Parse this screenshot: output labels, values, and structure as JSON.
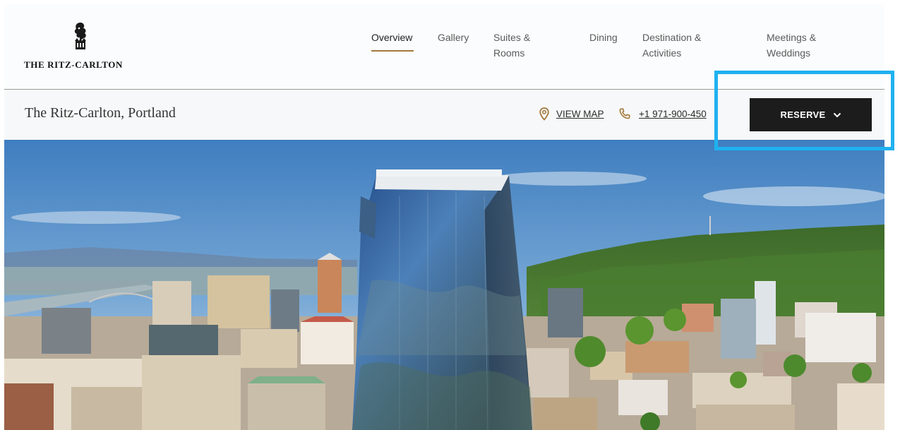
{
  "brand": {
    "logo_text": "THE RITZ-CARLTON",
    "logo_icon": "lion-crown-icon"
  },
  "nav": {
    "items": [
      {
        "label_lines": [
          "Overview"
        ],
        "active": true
      },
      {
        "label_lines": [
          "Gallery"
        ]
      },
      {
        "label_lines": [
          "Suites &",
          "Rooms"
        ]
      },
      {
        "label_lines": [
          "Dining"
        ]
      },
      {
        "label_lines": [
          "Destination &",
          "Activities"
        ]
      },
      {
        "label_lines": [
          "Meetings &",
          "Weddings"
        ]
      }
    ]
  },
  "property": {
    "name": "The Ritz-Carlton, Portland",
    "map_link": "VIEW MAP",
    "map_icon": "map-pin-icon",
    "phone": "+1 971-900-450",
    "phone_icon": "phone-icon",
    "reserve_label": "RESERVE",
    "reserve_icon": "chevron-down-icon"
  },
  "colors": {
    "accent": "#a3783a",
    "button": "#1c1c1c",
    "highlight": "#1fb1f0"
  },
  "hero": {
    "subject": "aerial photo of downtown Portland skyline with glass tower"
  }
}
